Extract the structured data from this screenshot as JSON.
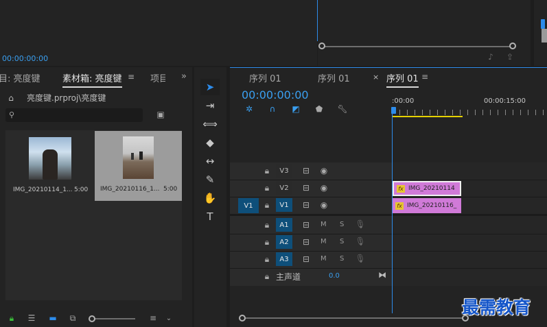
{
  "source_monitor": {
    "timecode": "00:00:00:00"
  },
  "project_panel": {
    "tabs": [
      {
        "label": "目: 亮度键"
      },
      {
        "label": "素材箱: 亮度键"
      },
      {
        "label": "项目"
      }
    ],
    "path": "亮度键.prproj\\亮度键",
    "search_placeholder": "",
    "items": [
      {
        "name": "IMG_20210114_1...",
        "duration": "5:00"
      },
      {
        "name": "IMG_20210116_1...",
        "duration": "5:00"
      }
    ]
  },
  "timeline": {
    "tabs": [
      {
        "label": "序列 01"
      },
      {
        "label": "序列 01"
      },
      {
        "label": "序列 01"
      }
    ],
    "close_symbol": "×",
    "timecode": "00:00:00:00",
    "ruler": {
      "start": ":00:00",
      "mark": "00:00:15:00"
    },
    "video_tracks": [
      {
        "name": "V3",
        "source": ""
      },
      {
        "name": "V2",
        "source": ""
      },
      {
        "name": "V1",
        "source": "V1"
      }
    ],
    "audio_tracks": [
      {
        "name": "A1",
        "m": "M",
        "s": "S"
      },
      {
        "name": "A2",
        "m": "M",
        "s": "S"
      },
      {
        "name": "A3",
        "m": "M",
        "s": "S"
      }
    ],
    "master": {
      "label": "主声道",
      "value": "0.0"
    },
    "clips": [
      {
        "label": "IMG_20210114",
        "fx": "fx"
      },
      {
        "label": "IMG_20210116_",
        "fx": "fx"
      }
    ]
  },
  "watermark": "最需教育",
  "colors": {
    "accent": "#2d8ceb",
    "clip": "#d07ad8",
    "track_on": "#0e4f7a",
    "work_area": "#e6d200"
  }
}
